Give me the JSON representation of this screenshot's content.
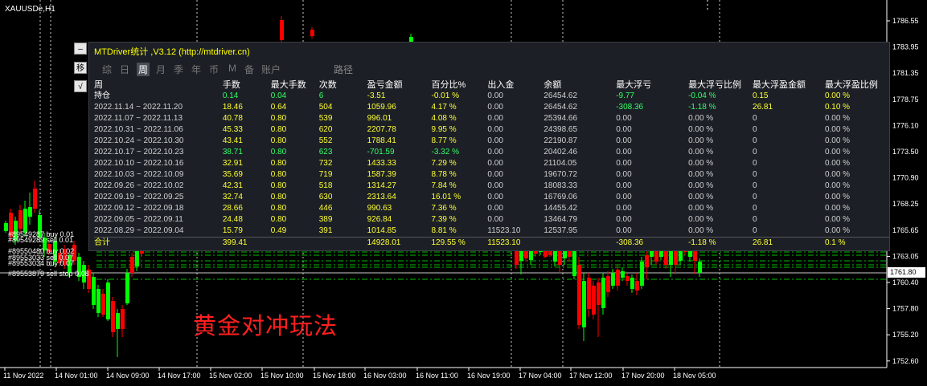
{
  "chart": {
    "symbol": "XAUUSDe,H1",
    "current_price": "1761.80",
    "price_levels": [
      "1786.55",
      "1783.95",
      "1781.35",
      "1778.75",
      "1776.10",
      "1773.50",
      "1770.90",
      "1768.25",
      "1765.65",
      "1763.05",
      "1760.40",
      "1757.80",
      "1755.20",
      "1752.60"
    ],
    "time_labels": [
      "11 Nov 2022",
      "14 Nov 01:00",
      "14 Nov 09:00",
      "14 Nov 17:00",
      "15 Nov 02:00",
      "15 Nov 10:00",
      "15 Nov 18:00",
      "16 Nov 03:00",
      "16 Nov 11:00",
      "16 Nov 19:00",
      "17 Nov 04:00",
      "17 Nov 12:00",
      "17 Nov 20:00",
      "18 Nov 05:00"
    ],
    "order_labels": [
      "#89549287 buy 0.01",
      "#89549289 sell 0.01",
      "#89550480 buy 0.02",
      "#89553033 sell 0.07",
      "#89553034 buy 0.07",
      "#89553879 sell stop 0.08"
    ],
    "caption": "黄金对冲玩法",
    "colors": {
      "bull": "#00ff00",
      "bear": "#ff0000",
      "grid": "#ffffff",
      "hedge_line": "#00c000"
    }
  },
  "panel": {
    "title": "MTDriver统计 ,V3.12 (http://mtdriver.cn)",
    "side_buttons": [
      "–",
      "移",
      "√"
    ],
    "tabs": [
      "综",
      "日",
      "周",
      "月",
      "季",
      "年",
      "币",
      "M",
      "备",
      "账户",
      "路径"
    ],
    "active_tab": "周",
    "headers": [
      "周",
      "手数",
      "最大手数",
      "次数",
      "盈亏金额",
      "百分比%",
      "出入金",
      "余额",
      "最大浮亏",
      "最大浮亏比例",
      "最大浮盈金额",
      "最大浮盈比例"
    ],
    "position_row": [
      "持仓",
      "0.14",
      "0.04",
      "6",
      "-3.51",
      "-0.01 %",
      "0.00",
      "26454.62",
      "-9.77",
      "-0.04 %",
      "0.15",
      "0.00 %"
    ],
    "rows": [
      [
        "2022.11.14 ~ 2022.11.20",
        "18.46",
        "0.64",
        "504",
        "1059.96",
        "4.17 %",
        "0.00",
        "26454.62",
        "-308.36",
        "-1.18 %",
        "26.81",
        "0.10 %"
      ],
      [
        "2022.11.07 ~ 2022.11.13",
        "40.78",
        "0.80",
        "539",
        "996.01",
        "4.08 %",
        "0.00",
        "25394.66",
        "0.00",
        "0.00 %",
        "0",
        "0.00 %"
      ],
      [
        "2022.10.31 ~ 2022.11.06",
        "45.33",
        "0.80",
        "620",
        "2207.78",
        "9.95 %",
        "0.00",
        "24398.65",
        "0.00",
        "0.00 %",
        "0",
        "0.00 %"
      ],
      [
        "2022.10.24 ~ 2022.10.30",
        "43.41",
        "0.80",
        "552",
        "1788.41",
        "8.77 %",
        "0.00",
        "22190.87",
        "0.00",
        "0.00 %",
        "0",
        "0.00 %"
      ],
      [
        "2022.10.17 ~ 2022.10.23",
        "38.71",
        "0.80",
        "623",
        "-701.59",
        "-3.32 %",
        "0.00",
        "20402.46",
        "0.00",
        "0.00 %",
        "0",
        "0.00 %"
      ],
      [
        "2022.10.10 ~ 2022.10.16",
        "32.91",
        "0.80",
        "732",
        "1433.33",
        "7.29 %",
        "0.00",
        "21104.05",
        "0.00",
        "0.00 %",
        "0",
        "0.00 %"
      ],
      [
        "2022.10.03 ~ 2022.10.09",
        "35.69",
        "0.80",
        "719",
        "1587.39",
        "8.78 %",
        "0.00",
        "19670.72",
        "0.00",
        "0.00 %",
        "0",
        "0.00 %"
      ],
      [
        "2022.09.26 ~ 2022.10.02",
        "42.31",
        "0.80",
        "518",
        "1314.27",
        "7.84 %",
        "0.00",
        "18083.33",
        "0.00",
        "0.00 %",
        "0",
        "0.00 %"
      ],
      [
        "2022.09.19 ~ 2022.09.25",
        "32.74",
        "0.80",
        "630",
        "2313.64",
        "16.01 %",
        "0.00",
        "16769.06",
        "0.00",
        "0.00 %",
        "0",
        "0.00 %"
      ],
      [
        "2022.09.12 ~ 2022.09.18",
        "28.66",
        "0.80",
        "446",
        "990.63",
        "7.36 %",
        "0.00",
        "14455.42",
        "0.00",
        "0.00 %",
        "0",
        "0.00 %"
      ],
      [
        "2022.09.05 ~ 2022.09.11",
        "24.48",
        "0.80",
        "389",
        "926.84",
        "7.39 %",
        "0.00",
        "13464.79",
        "0.00",
        "0.00 %",
        "0",
        "0.00 %"
      ],
      [
        "2022.08.29 ~ 2022.09.04",
        "15.79",
        "0.49",
        "391",
        "1014.85",
        "8.81 %",
        "11523.10",
        "12537.95",
        "0.00",
        "0.00 %",
        "0",
        "0.00 %"
      ]
    ],
    "total_row": [
      "合计",
      "399.41",
      "",
      "",
      "14928.01",
      "129.55 %",
      "11523.10",
      "",
      "-308.36",
      "-1.18 %",
      "26.81",
      "0.1 %"
    ]
  }
}
